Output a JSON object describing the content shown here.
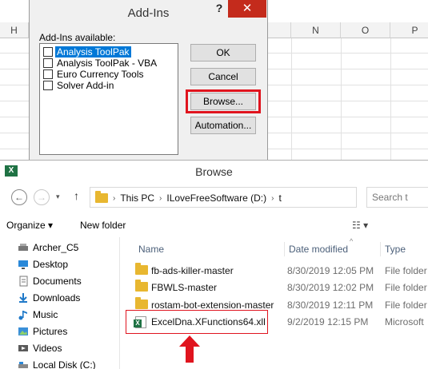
{
  "excel": {
    "column_headers": [
      "H",
      "N",
      "O",
      "P"
    ]
  },
  "addins_dialog": {
    "title": "Add-Ins",
    "help_label": "?",
    "close_label": "✕",
    "available_label": "Add-Ins available:",
    "items": [
      {
        "label": "Analysis ToolPak",
        "selected": true
      },
      {
        "label": "Analysis ToolPak - VBA",
        "selected": false
      },
      {
        "label": "Euro Currency Tools",
        "selected": false
      },
      {
        "label": "Solver Add-in",
        "selected": false
      }
    ],
    "buttons": {
      "ok": "OK",
      "cancel": "Cancel",
      "browse": "Browse...",
      "automation": "Automation..."
    },
    "highlight_color": "#e0141e"
  },
  "browse_window": {
    "title": "Browse",
    "app_icon": "X",
    "path": [
      "This PC",
      "ILoveFreeSoftware (D:)",
      "t"
    ],
    "search_placeholder": "Search t",
    "toolbar": {
      "organize": "Organize ▾",
      "new_folder": "New folder",
      "view": "☷ ▾"
    },
    "nav_items": [
      {
        "label": "Archer_C5",
        "icon": "drive-icon"
      },
      {
        "label": "Desktop",
        "icon": "desktop-icon"
      },
      {
        "label": "Documents",
        "icon": "documents-icon"
      },
      {
        "label": "Downloads",
        "icon": "downloads-icon"
      },
      {
        "label": "Music",
        "icon": "music-icon"
      },
      {
        "label": "Pictures",
        "icon": "pictures-icon"
      },
      {
        "label": "Videos",
        "icon": "videos-icon"
      },
      {
        "label": "Local Disk (C:)",
        "icon": "disk-icon"
      }
    ],
    "columns": {
      "name": "Name",
      "date": "Date modified",
      "type": "Type"
    },
    "files": [
      {
        "name": "fb-ads-killer-master",
        "date": "8/30/2019 12:05 PM",
        "type": "File folder",
        "icon": "folder-icon"
      },
      {
        "name": "FBWLS-master",
        "date": "8/30/2019 12:02 PM",
        "type": "File folder",
        "icon": "folder-icon"
      },
      {
        "name": "rostam-bot-extension-master",
        "date": "8/30/2019 12:11 PM",
        "type": "File folder",
        "icon": "folder-icon"
      },
      {
        "name": "ExcelDna.XFunctions64.xll",
        "date": "9/2/2019 12:15 PM",
        "type": "Microsoft",
        "icon": "xll-file-icon"
      }
    ]
  }
}
